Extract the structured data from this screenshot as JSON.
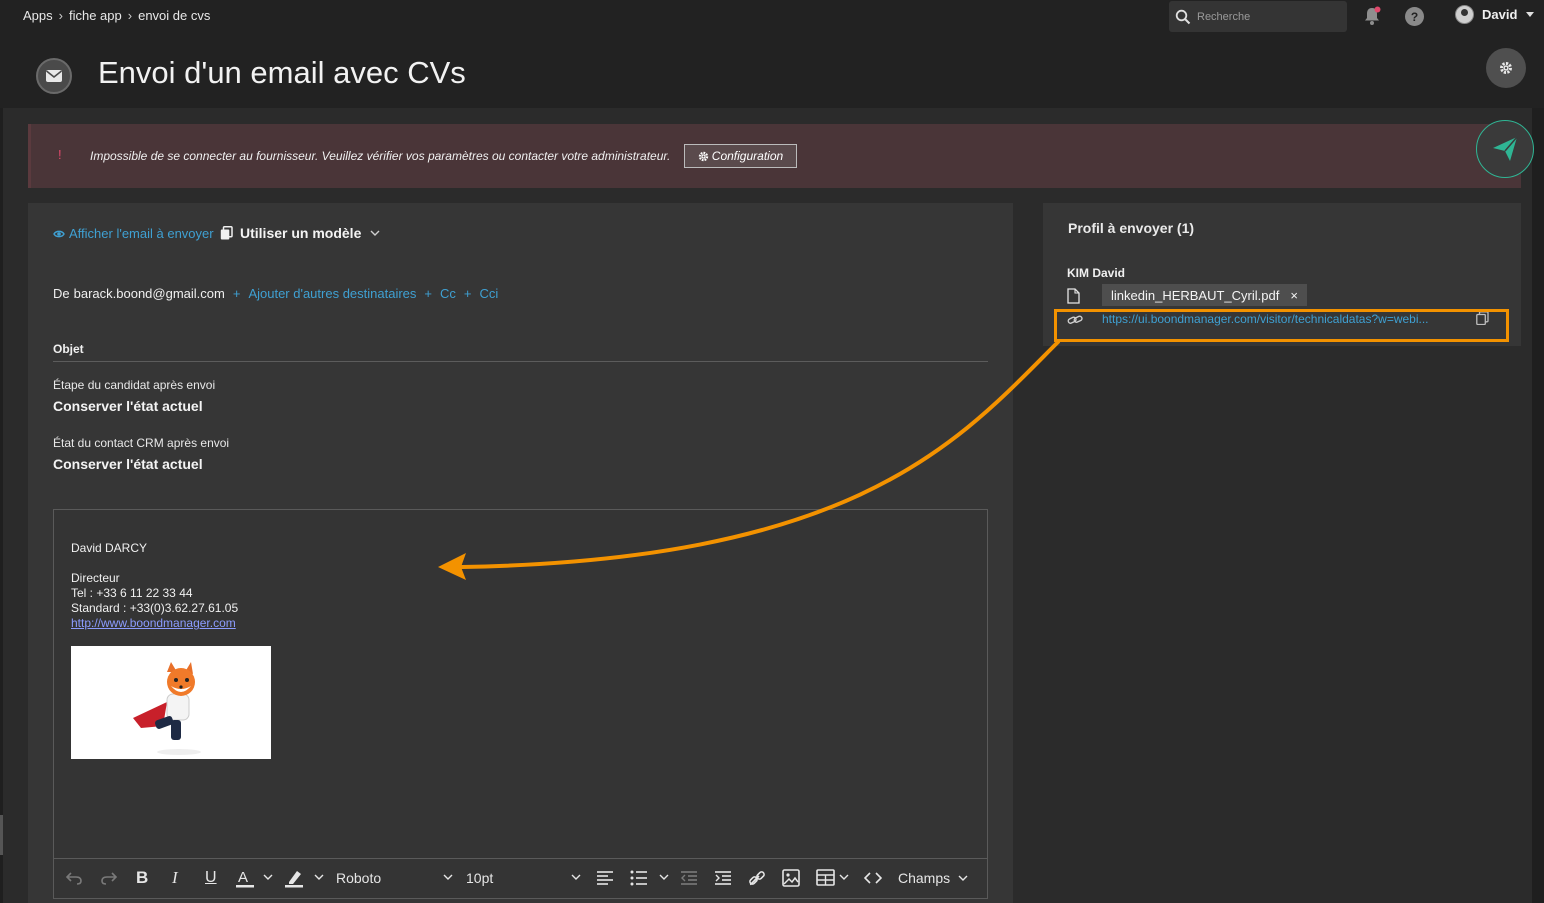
{
  "breadcrumb": [
    "Apps",
    "fiche app",
    "envoi de cvs"
  ],
  "search": {
    "placeholder": "Recherche"
  },
  "user": {
    "name": "David"
  },
  "help": {
    "label": "?"
  },
  "page": {
    "title": "Envoi d'un email avec CVs"
  },
  "alert": {
    "mark": "!",
    "message": "Impossible de se connecter au fournisseur. Veuillez vérifier vos paramètres ou contacter votre administrateur.",
    "button": "Configuration"
  },
  "email": {
    "show_email": "Afficher l'email à envoyer",
    "use_template": "Utiliser un modèle",
    "from_prefix": "De",
    "from_address": "barack.boond@gmail.com",
    "add_recipients": "Ajouter d'autres destinataires",
    "cc": "Cc",
    "cci": "Cci",
    "subject_label": "Objet",
    "candidate_step_label": "Étape du candidat après envoi",
    "candidate_step_value": "Conserver l'état actuel",
    "crm_state_label": "État du contact CRM après envoi",
    "crm_state_value": "Conserver l'état actuel"
  },
  "signature": {
    "name": "David DARCY",
    "role": "Directeur",
    "tel": "Tel : +33 6 11 22 33 44",
    "standard": "Standard : +33(0)3.62.27.61.05",
    "website": "http://www.boondmanager.com"
  },
  "toolbar": {
    "font": "Roboto",
    "size": "10pt",
    "fields": "Champs"
  },
  "profiles": {
    "title": "Profil à envoyer (1)",
    "name": "KIM David",
    "file": "linkedin_HERBAUT_Cyril.pdf",
    "remove": "×",
    "url": "https://ui.boondmanager.com/visitor/technicaldatas?w=webi..."
  },
  "colors": {
    "accent": "#3fa0d2",
    "annotation": "#f39200",
    "send": "#2fb594",
    "alert_bg": "#4a3538"
  }
}
